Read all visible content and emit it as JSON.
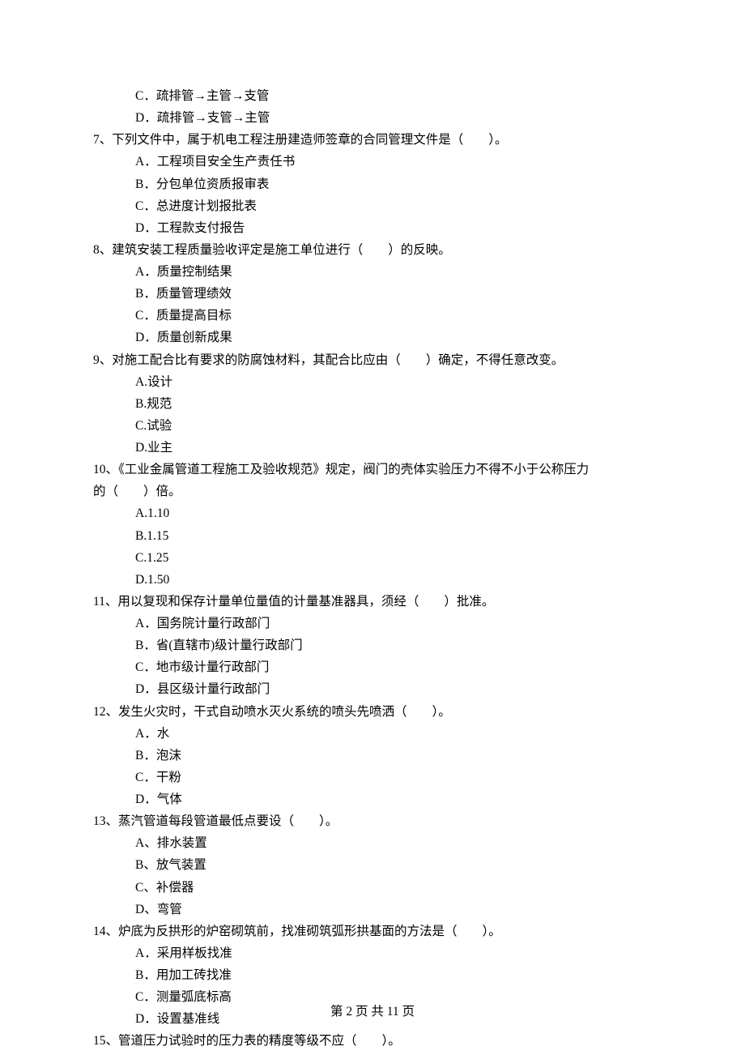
{
  "q6": {
    "options": {
      "c": "C．疏排管→主管→支管",
      "d": "D．疏排管→支管→主管"
    }
  },
  "q7": {
    "stem": "7、下列文件中，属于机电工程注册建造师签章的合同管理文件是（　　）。",
    "options": {
      "a": "A．工程项目安全生产责任书",
      "b": "B．分包单位资质报审表",
      "c": "C．总进度计划报批表",
      "d": "D．工程款支付报告"
    }
  },
  "q8": {
    "stem": "8、建筑安装工程质量验收评定是施工单位进行（　　）的反映。",
    "options": {
      "a": "A．质量控制结果",
      "b": "B．质量管理绩效",
      "c": "C．质量提高目标",
      "d": "D．质量创新成果"
    }
  },
  "q9": {
    "stem": "9、对施工配合比有要求的防腐蚀材料，其配合比应由（　　）确定，不得任意改变。",
    "options": {
      "a": "A.设计",
      "b": "B.规范",
      "c": "C.试验",
      "d": "D.业主"
    }
  },
  "q10": {
    "stem1": "10、《工业金属管道工程施工及验收规范》规定，阀门的壳体实验压力不得不小于公称压力",
    "stem2": "的（　　）倍。",
    "options": {
      "a": "A.1.10",
      "b": "B.1.15",
      "c": "C.1.25",
      "d": "D.1.50"
    }
  },
  "q11": {
    "stem": "11、用以复现和保存计量单位量值的计量基准器具，须经（　　）批准。",
    "options": {
      "a": "A．国务院计量行政部门",
      "b": "B．省(直辖市)级计量行政部门",
      "c": "C．地市级计量行政部门",
      "d": "D．县区级计量行政部门"
    }
  },
  "q12": {
    "stem": "12、发生火灾时，干式自动喷水灭火系统的喷头先喷洒（　　）。",
    "options": {
      "a": "A．水",
      "b": "B．泡沫",
      "c": "C．干粉",
      "d": "D．气体"
    }
  },
  "q13": {
    "stem": "13、蒸汽管道每段管道最低点要设（　　）。",
    "options": {
      "a": "A、排水装置",
      "b": "B、放气装置",
      "c": "C、补偿器",
      "d": "D、弯管"
    }
  },
  "q14": {
    "stem": "14、炉底为反拱形的炉窑砌筑前，找准砌筑弧形拱基面的方法是（　　）。",
    "options": {
      "a": "A．采用样板找准",
      "b": "B．用加工砖找准",
      "c": "C．测量弧底标高",
      "d": "D．设置基准线"
    }
  },
  "q15": {
    "stem": "15、管道压力试验时的压力表的精度等级不应（　　）。"
  },
  "footer": "第 2 页 共 11 页"
}
